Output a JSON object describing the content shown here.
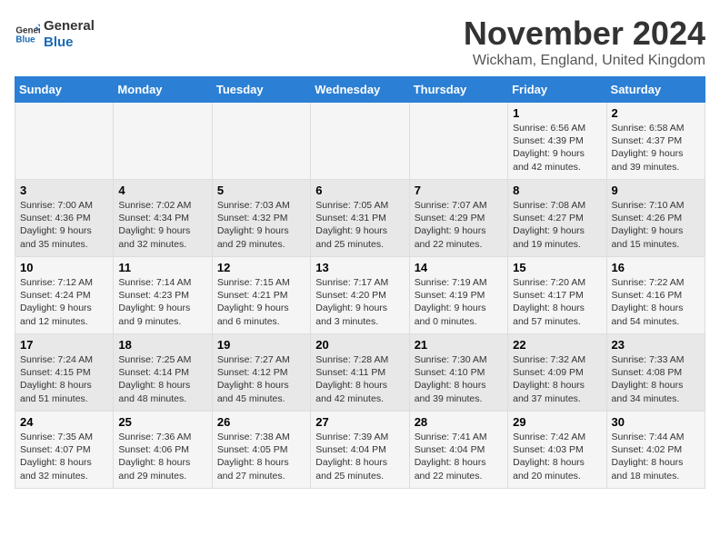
{
  "logo": {
    "line1": "General",
    "line2": "Blue"
  },
  "title": "November 2024",
  "subtitle": "Wickham, England, United Kingdom",
  "days_of_week": [
    "Sunday",
    "Monday",
    "Tuesday",
    "Wednesday",
    "Thursday",
    "Friday",
    "Saturday"
  ],
  "weeks": [
    [
      {
        "day": "",
        "text": ""
      },
      {
        "day": "",
        "text": ""
      },
      {
        "day": "",
        "text": ""
      },
      {
        "day": "",
        "text": ""
      },
      {
        "day": "",
        "text": ""
      },
      {
        "day": "1",
        "text": "Sunrise: 6:56 AM\nSunset: 4:39 PM\nDaylight: 9 hours and 42 minutes."
      },
      {
        "day": "2",
        "text": "Sunrise: 6:58 AM\nSunset: 4:37 PM\nDaylight: 9 hours and 39 minutes."
      }
    ],
    [
      {
        "day": "3",
        "text": "Sunrise: 7:00 AM\nSunset: 4:36 PM\nDaylight: 9 hours and 35 minutes."
      },
      {
        "day": "4",
        "text": "Sunrise: 7:02 AM\nSunset: 4:34 PM\nDaylight: 9 hours and 32 minutes."
      },
      {
        "day": "5",
        "text": "Sunrise: 7:03 AM\nSunset: 4:32 PM\nDaylight: 9 hours and 29 minutes."
      },
      {
        "day": "6",
        "text": "Sunrise: 7:05 AM\nSunset: 4:31 PM\nDaylight: 9 hours and 25 minutes."
      },
      {
        "day": "7",
        "text": "Sunrise: 7:07 AM\nSunset: 4:29 PM\nDaylight: 9 hours and 22 minutes."
      },
      {
        "day": "8",
        "text": "Sunrise: 7:08 AM\nSunset: 4:27 PM\nDaylight: 9 hours and 19 minutes."
      },
      {
        "day": "9",
        "text": "Sunrise: 7:10 AM\nSunset: 4:26 PM\nDaylight: 9 hours and 15 minutes."
      }
    ],
    [
      {
        "day": "10",
        "text": "Sunrise: 7:12 AM\nSunset: 4:24 PM\nDaylight: 9 hours and 12 minutes."
      },
      {
        "day": "11",
        "text": "Sunrise: 7:14 AM\nSunset: 4:23 PM\nDaylight: 9 hours and 9 minutes."
      },
      {
        "day": "12",
        "text": "Sunrise: 7:15 AM\nSunset: 4:21 PM\nDaylight: 9 hours and 6 minutes."
      },
      {
        "day": "13",
        "text": "Sunrise: 7:17 AM\nSunset: 4:20 PM\nDaylight: 9 hours and 3 minutes."
      },
      {
        "day": "14",
        "text": "Sunrise: 7:19 AM\nSunset: 4:19 PM\nDaylight: 9 hours and 0 minutes."
      },
      {
        "day": "15",
        "text": "Sunrise: 7:20 AM\nSunset: 4:17 PM\nDaylight: 8 hours and 57 minutes."
      },
      {
        "day": "16",
        "text": "Sunrise: 7:22 AM\nSunset: 4:16 PM\nDaylight: 8 hours and 54 minutes."
      }
    ],
    [
      {
        "day": "17",
        "text": "Sunrise: 7:24 AM\nSunset: 4:15 PM\nDaylight: 8 hours and 51 minutes."
      },
      {
        "day": "18",
        "text": "Sunrise: 7:25 AM\nSunset: 4:14 PM\nDaylight: 8 hours and 48 minutes."
      },
      {
        "day": "19",
        "text": "Sunrise: 7:27 AM\nSunset: 4:12 PM\nDaylight: 8 hours and 45 minutes."
      },
      {
        "day": "20",
        "text": "Sunrise: 7:28 AM\nSunset: 4:11 PM\nDaylight: 8 hours and 42 minutes."
      },
      {
        "day": "21",
        "text": "Sunrise: 7:30 AM\nSunset: 4:10 PM\nDaylight: 8 hours and 39 minutes."
      },
      {
        "day": "22",
        "text": "Sunrise: 7:32 AM\nSunset: 4:09 PM\nDaylight: 8 hours and 37 minutes."
      },
      {
        "day": "23",
        "text": "Sunrise: 7:33 AM\nSunset: 4:08 PM\nDaylight: 8 hours and 34 minutes."
      }
    ],
    [
      {
        "day": "24",
        "text": "Sunrise: 7:35 AM\nSunset: 4:07 PM\nDaylight: 8 hours and 32 minutes."
      },
      {
        "day": "25",
        "text": "Sunrise: 7:36 AM\nSunset: 4:06 PM\nDaylight: 8 hours and 29 minutes."
      },
      {
        "day": "26",
        "text": "Sunrise: 7:38 AM\nSunset: 4:05 PM\nDaylight: 8 hours and 27 minutes."
      },
      {
        "day": "27",
        "text": "Sunrise: 7:39 AM\nSunset: 4:04 PM\nDaylight: 8 hours and 25 minutes."
      },
      {
        "day": "28",
        "text": "Sunrise: 7:41 AM\nSunset: 4:04 PM\nDaylight: 8 hours and 22 minutes."
      },
      {
        "day": "29",
        "text": "Sunrise: 7:42 AM\nSunset: 4:03 PM\nDaylight: 8 hours and 20 minutes."
      },
      {
        "day": "30",
        "text": "Sunrise: 7:44 AM\nSunset: 4:02 PM\nDaylight: 8 hours and 18 minutes."
      }
    ]
  ]
}
